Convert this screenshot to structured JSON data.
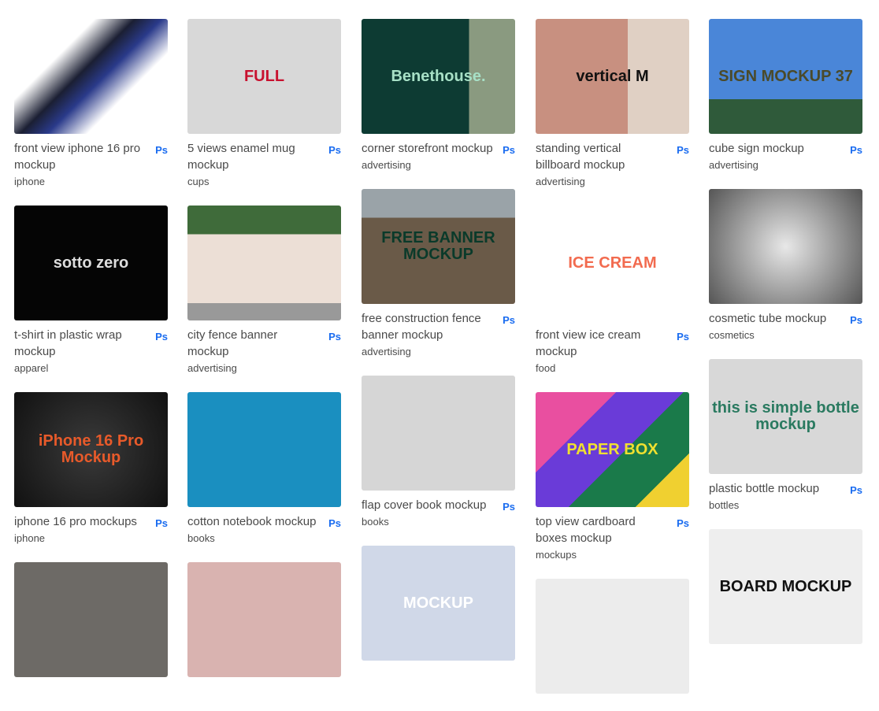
{
  "badge_label": "Ps",
  "colors": {
    "text": "#4a4a4a",
    "badge": "#1a6cf0"
  },
  "columns": [
    [
      {
        "title": "front view iphone 16 pro mockup",
        "category": "iphone",
        "bg": "linear-gradient(135deg,#fff 30%,#1b1f33 45%,#2a3a8a 55%,#fff 70%)",
        "art": ""
      },
      {
        "title": "t-shirt in plastic wrap mockup",
        "category": "apparel",
        "bg": "#050505",
        "art": "sotto zero",
        "artColor": "#ddd"
      },
      {
        "title": "iphone 16 pro mockups",
        "category": "iphone",
        "bg": "radial-gradient(circle,#3a3a3a,#111)",
        "art": "iPhone 16 Pro Mockup",
        "artColor": "#e85a2a"
      },
      {
        "title": "",
        "category": "",
        "bg": "#6d6a66",
        "art": ""
      }
    ],
    [
      {
        "title": "5 views enamel mug mockup",
        "category": "cups",
        "bg": "#d8d8d8",
        "art": "FULL",
        "artColor": "#c8102e"
      },
      {
        "title": "city fence banner mockup",
        "category": "advertising",
        "bg": "linear-gradient(#3f6b3a 0 25%,#ecdfd6 25% 85%,#999 85%)",
        "art": "",
        "artColor": "#333"
      },
      {
        "title": "cotton notebook mockup",
        "category": "books",
        "bg": "#1a8fc0",
        "art": "",
        "artColor": "#333"
      },
      {
        "title": "",
        "category": "",
        "bg": "#d9b3b0",
        "art": ""
      }
    ],
    [
      {
        "title": "corner storefront mockup",
        "category": "advertising",
        "bg": "linear-gradient(90deg,#0d3b33 70%,#8a9a80 70%)",
        "art": "Benethouse.",
        "artColor": "#a7e0c6"
      },
      {
        "title": "free construction fence banner mockup",
        "category": "advertising",
        "bg": "linear-gradient(#9aa3a8 0 25%,#6a5a48 25%)",
        "art": "FREE BANNER MOCKUP",
        "artColor": "#0a3a2a"
      },
      {
        "title": "flap cover book mockup",
        "category": "books",
        "bg": "#d6d6d6",
        "art": "",
        "artColor": "#333"
      },
      {
        "title": "",
        "category": "",
        "bg": "#d0d8e8",
        "art": "MOCKUP",
        "artColor": "#fff"
      }
    ],
    [
      {
        "title": "standing vertical billboard mockup",
        "category": "advertising",
        "bg": "linear-gradient(90deg,#c89080 60%,#e0d0c4 60%)",
        "art": "vertical M",
        "artColor": "#111"
      },
      {
        "title": "front view ice cream mockup",
        "category": "food",
        "bg": "#ffffff",
        "art": "ICE CREAM",
        "artColor": "#f26b4f"
      },
      {
        "title": "top view cardboard boxes mockup",
        "category": "mockups",
        "bg": "linear-gradient(135deg,#e94fa0 0 30%,#6a3bd8 30% 55%,#1a7a4a 55% 80%,#f0d030 80%)",
        "art": "PAPER BOX",
        "artColor": "#f0e030"
      },
      {
        "title": "",
        "category": "",
        "bg": "#ececec",
        "art": ""
      }
    ],
    [
      {
        "title": "cube sign mockup",
        "category": "advertising",
        "bg": "linear-gradient(#4a86d8 70%,#2f5a3a 70%)",
        "art": "SIGN MOCKUP 37",
        "artColor": "#4a4a2a"
      },
      {
        "title": "cosmetic tube mockup",
        "category": "cosmetics",
        "bg": "radial-gradient(circle,#e8e8e8,#555)",
        "art": "",
        "artColor": "#333"
      },
      {
        "title": "plastic bottle mockup",
        "category": "bottles",
        "bg": "#d8d8d8",
        "art": "this is simple bottle mockup",
        "artColor": "#2a7a60"
      },
      {
        "title": "",
        "category": "",
        "bg": "#eeeeee",
        "art": "BOARD MOCKUP",
        "artColor": "#111"
      }
    ]
  ]
}
